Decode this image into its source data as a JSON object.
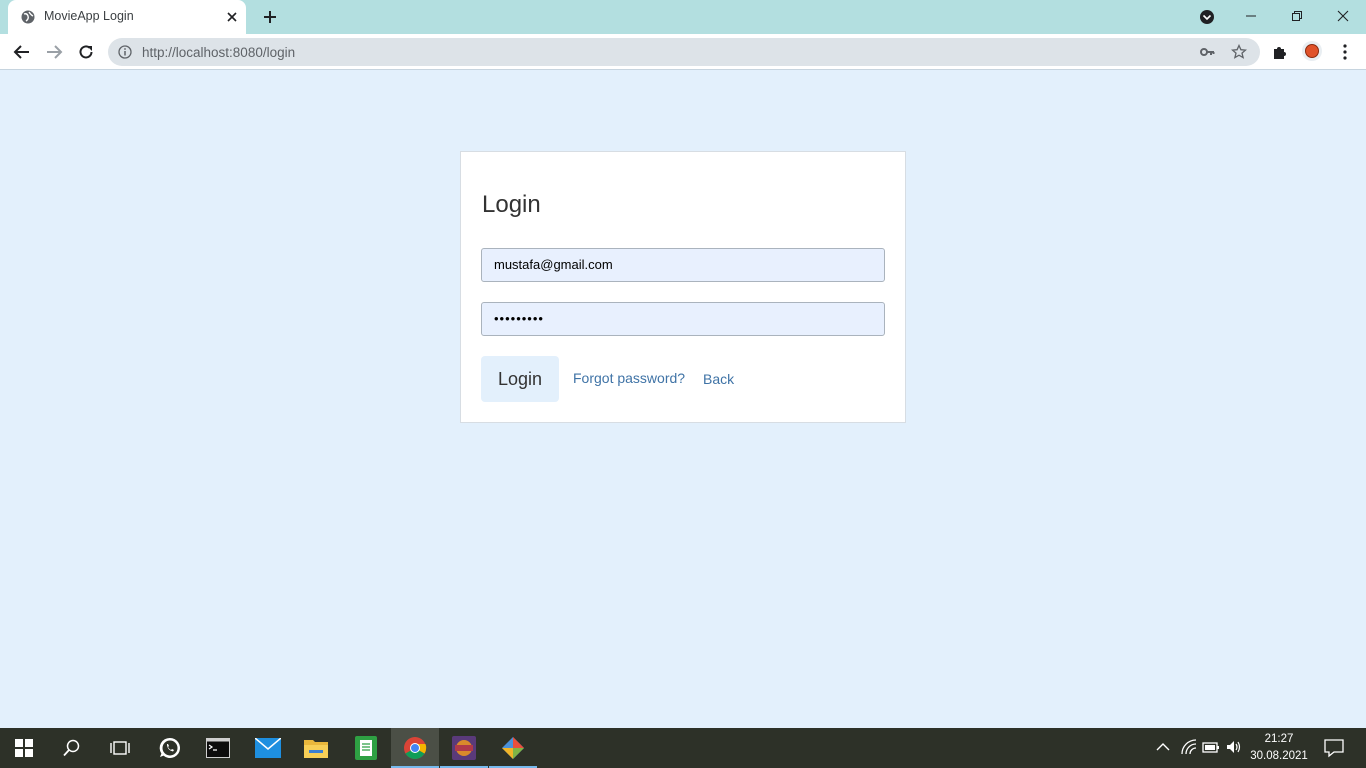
{
  "browser": {
    "tab_title": "MovieApp Login",
    "url": "http://localhost:8080/login"
  },
  "login": {
    "heading": "Login",
    "email_value": "mustafa@gmail.com",
    "password_value": "•••••••••",
    "submit_label": "Login",
    "forgot_label": "Forgot password?",
    "back_label": "Back"
  },
  "taskbar": {
    "time": "21:27",
    "date": "30.08.2021",
    "pinned": [
      "windows-start",
      "search",
      "task-view",
      "whatsapp",
      "terminal",
      "mail",
      "file-explorer",
      "notepad",
      "chrome",
      "game",
      "git"
    ]
  },
  "colors": {
    "page_bg": "#e3f0fc",
    "tab_strip": "#b3dfe0",
    "link": "#3f73a6",
    "taskbar": "#2d3128"
  }
}
